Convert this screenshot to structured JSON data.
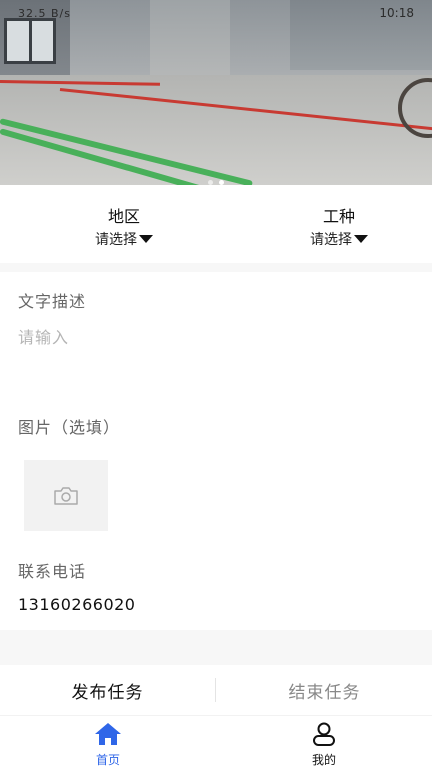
{
  "status_bar": {
    "left_text": "32.5 B/s",
    "right_text": "10:18"
  },
  "banner": {
    "dot_count": 2,
    "active_dot": 1
  },
  "filters": {
    "region": {
      "title": "地区",
      "value": "请选择"
    },
    "trade": {
      "title": "工种",
      "value": "请选择"
    }
  },
  "form": {
    "description": {
      "label": "文字描述",
      "placeholder": "请输入"
    },
    "images": {
      "label": "图片（选填）",
      "icon": "camera-icon"
    },
    "contact": {
      "label": "联系电话",
      "value": "13160266020"
    }
  },
  "actions": {
    "publish": "发布任务",
    "end": "结束任务"
  },
  "tabbar": {
    "home": {
      "label": "首页",
      "icon": "home-icon",
      "active": true
    },
    "mine": {
      "label": "我的",
      "icon": "user-icon",
      "active": false
    }
  },
  "colors": {
    "accent": "#2f66e8",
    "background": "#f7f7f7"
  }
}
